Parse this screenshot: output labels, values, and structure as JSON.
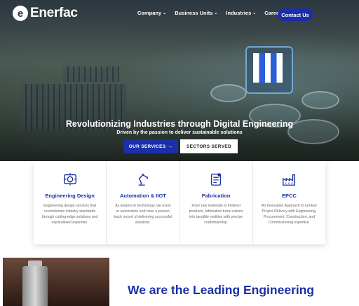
{
  "brand": {
    "logo_letter": "e",
    "name": "Enerfac"
  },
  "nav": {
    "items": [
      {
        "label": "Company"
      },
      {
        "label": "Business Units"
      },
      {
        "label": "Industries"
      },
      {
        "label": "Careers"
      }
    ],
    "contact_label": "Contact Us"
  },
  "hero": {
    "title": "Revolutionizing Industries through Digital Engineering",
    "subtitle": "Driven by the passion to deliver sustainable solutions",
    "primary_button": "OUR SERVICES",
    "primary_arrow": "→",
    "secondary_button": "SECTORS SERVED"
  },
  "services": [
    {
      "icon": "engineering-design-icon",
      "title": "Engineering Design",
      "description": "Engineering design services that revolutionize industry standards through cutting-edge solutions and unparalleled expertise."
    },
    {
      "icon": "robot-arm-icon",
      "title": "Automation & IIOT",
      "description": "As leaders in technology, we excel in automation and have a proven track record of delivering successful solutions."
    },
    {
      "icon": "fabrication-icon",
      "title": "Fabrication",
      "description": "From raw materials to finished products, fabrication turns visions into tangible realities with precise craftsmanship."
    },
    {
      "icon": "factory-icon",
      "title": "EPCC",
      "description": "An Innovative Approach to turnkey Project Delivery with Engineering, Procurement, Construction, and Commissioning expertise."
    }
  ],
  "about": {
    "heading": "We are the Leading Engineering"
  },
  "colors": {
    "accent": "#1b2fa8",
    "white": "#ffffff"
  }
}
